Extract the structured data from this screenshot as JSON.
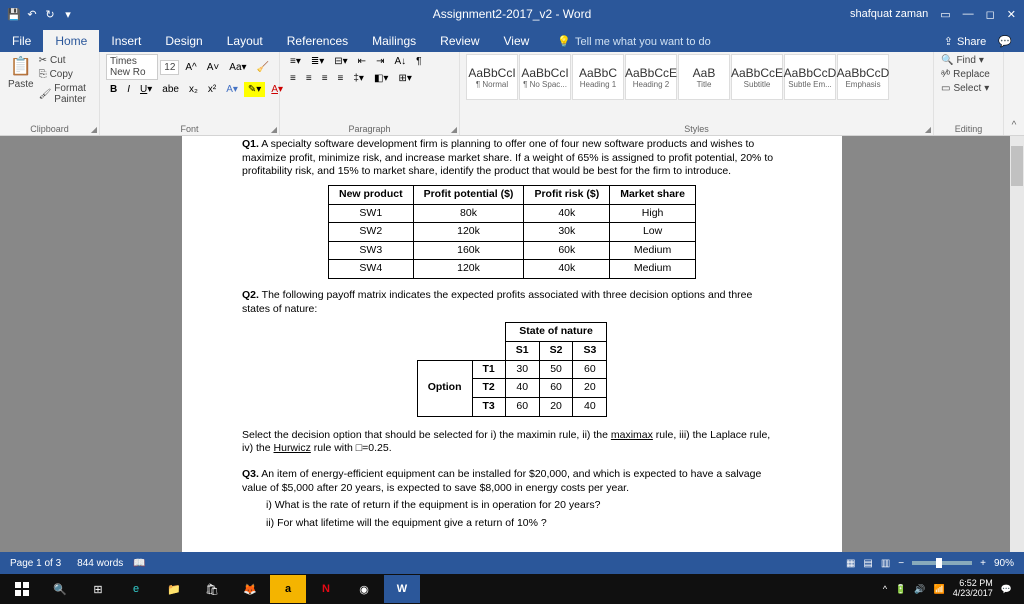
{
  "title": "Assignment2-2017_v2 - Word",
  "user": "shafquat zaman",
  "tabs": [
    "File",
    "Home",
    "Insert",
    "Design",
    "Layout",
    "References",
    "Mailings",
    "Review",
    "View"
  ],
  "tellme": "Tell me what you want to do",
  "share": "Share",
  "clipboard": {
    "paste": "Paste",
    "cut": "Cut",
    "copy": "Copy",
    "painter": "Format Painter",
    "label": "Clipboard"
  },
  "font": {
    "name": "Times New Ro",
    "size": "12",
    "label": "Font"
  },
  "paragraph": {
    "label": "Paragraph"
  },
  "styles": {
    "label": "Styles",
    "items": [
      {
        "prev": "AaBbCcI",
        "name": "¶ Normal"
      },
      {
        "prev": "AaBbCcI",
        "name": "¶ No Spac..."
      },
      {
        "prev": "AaBbC",
        "name": "Heading 1"
      },
      {
        "prev": "AaBbCcE",
        "name": "Heading 2"
      },
      {
        "prev": "AaB",
        "name": "Title"
      },
      {
        "prev": "AaBbCcE",
        "name": "Subtitle"
      },
      {
        "prev": "AaBbCcD",
        "name": "Subtle Em..."
      },
      {
        "prev": "AaBbCcD",
        "name": "Emphasis"
      }
    ]
  },
  "editing": {
    "find": "Find",
    "replace": "Replace",
    "select": "Select",
    "label": "Editing"
  },
  "doc": {
    "q1_intro": "Q1. A specialty software development firm is planning to offer one of four new software products and wishes to maximize profit, minimize risk, and increase market share. If a weight of 65% is assigned to profit potential, 20% to profitability risk, and 15% to market share, identify the product that would be best for the firm to introduce.",
    "t1_headers": [
      "New product",
      "Profit potential ($)",
      "Profit risk ($)",
      "Market share"
    ],
    "t1_rows": [
      [
        "SW1",
        "80k",
        "40k",
        "High"
      ],
      [
        "SW2",
        "120k",
        "30k",
        "Low"
      ],
      [
        "SW3",
        "160k",
        "60k",
        "Medium"
      ],
      [
        "SW4",
        "120k",
        "40k",
        "Medium"
      ]
    ],
    "q2_intro": "Q2. The following payoff matrix indicates the expected profits associated with three decision options and three states of nature:",
    "t2_state": "State of nature",
    "t2_cols": [
      "S1",
      "S2",
      "S3"
    ],
    "t2_opt": "Option",
    "t2_rows": [
      [
        "T1",
        "30",
        "50",
        "60"
      ],
      [
        "T2",
        "40",
        "60",
        "20"
      ],
      [
        "T3",
        "60",
        "20",
        "40"
      ]
    ],
    "q2_body_a": "Select the decision option that should be selected for i) the maximin rule, ii) the ",
    "q2_maximax": "maximax",
    "q2_body_b": " rule, iii) the Laplace rule, iv) the ",
    "q2_hurwicz": "Hurwicz",
    "q2_body_c": " rule with □=0.25.",
    "q3_a": "Q3. An item of energy-efficient equipment can be installed for $20,000, and which is expected to have a salvage value of $5,000 after 20 years, is expected to save $8,000 in energy costs per year.",
    "q3_i": "i)  What is the rate of return if the equipment is in operation for 20 years?",
    "q3_ii": "ii)  For what lifetime will the equipment give a return of 10% ?"
  },
  "status": {
    "page": "Page 1 of 3",
    "words": "844 words",
    "zoom": "90%"
  },
  "tray": {
    "time": "6:52 PM",
    "date": "4/23/2017"
  }
}
